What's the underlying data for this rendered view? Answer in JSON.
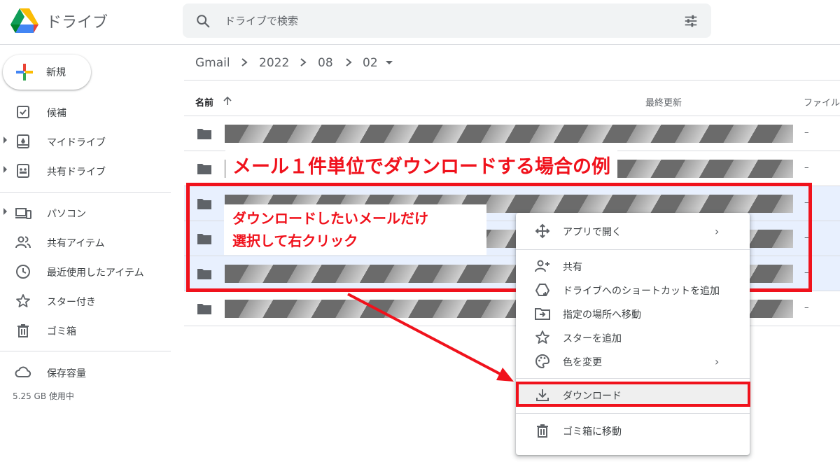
{
  "app": {
    "name": "ドライブ"
  },
  "search": {
    "placeholder": "ドライブで検索"
  },
  "sidebar": {
    "new_label": "新規",
    "items": [
      {
        "label": "候補",
        "icon": "check-box-icon"
      },
      {
        "label": "マイドライブ",
        "icon": "my-drive-icon"
      },
      {
        "label": "共有ドライブ",
        "icon": "shared-drives-icon"
      },
      {
        "label": "パソコン",
        "icon": "computers-icon"
      },
      {
        "label": "共有アイテム",
        "icon": "people-icon"
      },
      {
        "label": "最近使用したアイテム",
        "icon": "clock-icon"
      },
      {
        "label": "スター付き",
        "icon": "star-icon"
      },
      {
        "label": "ゴミ箱",
        "icon": "trash-icon"
      }
    ],
    "storage_label": "保存容量",
    "storage_used": "5.25 GB 使用中"
  },
  "breadcrumb": [
    "Gmail",
    "2022",
    "08",
    "02"
  ],
  "table": {
    "columns": {
      "name": "名前",
      "modified": "最終更新",
      "size": "ファイル"
    },
    "rows": [
      {
        "size": "–",
        "selected": false
      },
      {
        "size": "–",
        "selected": false
      },
      {
        "size": "–",
        "selected": true
      },
      {
        "size": "–",
        "selected": true
      },
      {
        "size": "–",
        "selected": true
      },
      {
        "size": "–",
        "selected": false
      }
    ]
  },
  "annotations": {
    "title": "メール１件単位でダウンロードする場合の例",
    "callout_line1": "ダウンロードしたいメールだけ",
    "callout_line2": "選択して右クリック",
    "color": "#f0121c"
  },
  "context_menu": {
    "items": [
      {
        "label": "アプリで開く",
        "icon": "open-with-icon",
        "submenu": "›"
      },
      {
        "label": "共有",
        "icon": "person-add-icon"
      },
      {
        "label": "ドライブへのショートカットを追加",
        "icon": "add-shortcut-icon"
      },
      {
        "label": "指定の場所へ移動",
        "icon": "move-to-folder-icon"
      },
      {
        "label": "スターを追加",
        "icon": "star-icon"
      },
      {
        "label": "色を変更",
        "icon": "palette-icon",
        "submenu": "›"
      },
      {
        "label": "ダウンロード",
        "icon": "download-icon"
      },
      {
        "label": "ゴミ箱に移動",
        "icon": "trash-icon"
      }
    ]
  },
  "colors": {
    "accent": "#f0121c",
    "selected_row": "#e8f0fe",
    "search_bg": "#f1f3f4"
  }
}
